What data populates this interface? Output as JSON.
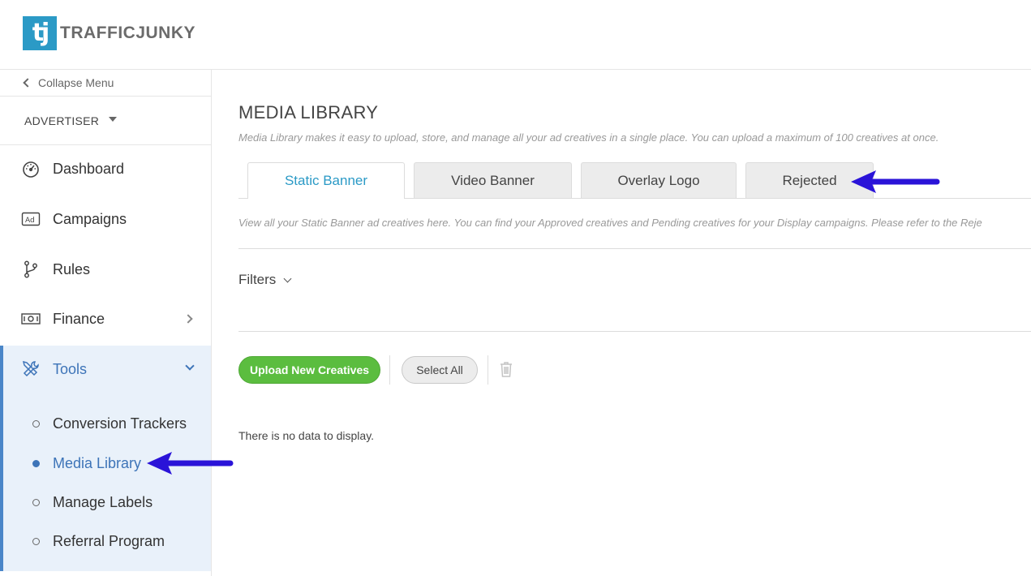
{
  "header": {
    "logo_mark": "tj",
    "logo_text": "TRAFFICJUNKY"
  },
  "sidebar": {
    "collapse_label": "Collapse Menu",
    "role_label": "ADVERTISER",
    "items": [
      {
        "label": "Dashboard",
        "icon": "gauge-icon"
      },
      {
        "label": "Campaigns",
        "icon": "ad-icon"
      },
      {
        "label": "Rules",
        "icon": "branch-icon"
      },
      {
        "label": "Finance",
        "icon": "money-icon"
      }
    ],
    "tools": {
      "label": "Tools",
      "icon": "tools-icon",
      "subitems": [
        {
          "label": "Conversion Trackers"
        },
        {
          "label": "Media Library"
        },
        {
          "label": "Manage Labels"
        },
        {
          "label": "Referral Program"
        }
      ]
    }
  },
  "main": {
    "title": "MEDIA LIBRARY",
    "description": "Media Library makes it easy to upload, store, and manage all your ad creatives in a single place. You can upload a maximum of 100 creatives at once.",
    "tabs": [
      {
        "label": "Static Banner"
      },
      {
        "label": "Video Banner"
      },
      {
        "label": "Overlay Logo"
      },
      {
        "label": "Rejected"
      }
    ],
    "tab_description": "View all your Static Banner ad creatives here. You can find your Approved creatives and Pending creatives for your Display campaigns. Please refer to the Reje",
    "filters_label": "Filters",
    "upload_label": "Upload New Creatives",
    "select_all_label": "Select All",
    "empty_message": "There is no data to display."
  },
  "colors": {
    "brand": "#2b9ac6",
    "active_nav": "#3d74b8",
    "upload_button": "#5bbd3f",
    "annotation_arrow": "#2a13d8"
  }
}
